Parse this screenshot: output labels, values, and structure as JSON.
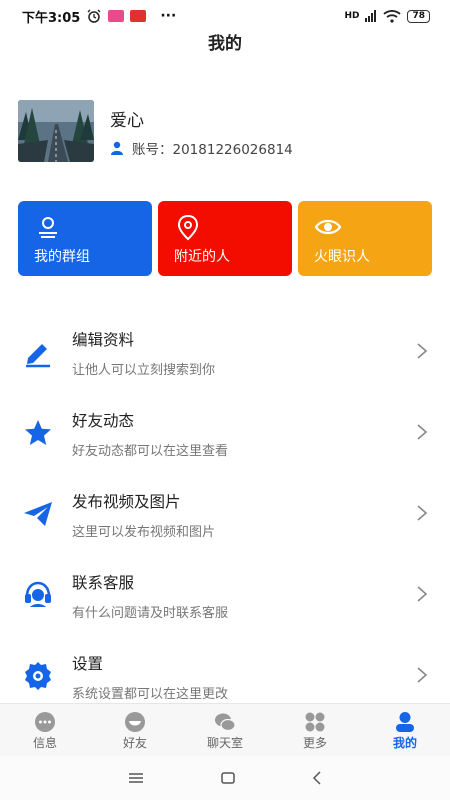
{
  "status": {
    "time": "下午3:05",
    "dots": "···",
    "battery": "78",
    "network": "HD"
  },
  "header": {
    "title": "我的"
  },
  "profile": {
    "name": "爱心",
    "account": "账号：20181226026814"
  },
  "cards": [
    {
      "label": "我的群组",
      "color": "#1565e6",
      "icon": "group-icon"
    },
    {
      "label": "附近的人",
      "color": "#f20d00",
      "icon": "location-pin-icon"
    },
    {
      "label": "火眼识人",
      "color": "#f5a414",
      "icon": "eye-icon"
    }
  ],
  "menu": [
    {
      "title": "编辑资料",
      "desc": "让他人可以立刻搜索到你",
      "icon": "edit-icon"
    },
    {
      "title": "好友动态",
      "desc": "好友动态都可以在这里查看",
      "icon": "star-icon"
    },
    {
      "title": "发布视频及图片",
      "desc": "这里可以发布视频和图片",
      "icon": "send-icon"
    },
    {
      "title": "联系客服",
      "desc": "有什么问题请及时联系客服",
      "icon": "headset-icon"
    },
    {
      "title": "设置",
      "desc": "系统设置都可以在这里更改",
      "icon": "gear-icon"
    }
  ],
  "tabs": [
    {
      "label": "信息",
      "icon": "message-icon"
    },
    {
      "label": "好友",
      "icon": "friend-icon"
    },
    {
      "label": "聊天室",
      "icon": "chatroom-icon"
    },
    {
      "label": "更多",
      "icon": "more-grid-icon"
    },
    {
      "label": "我的",
      "icon": "person-icon",
      "active": true
    }
  ],
  "colors": {
    "accent": "#1565e6",
    "tab_inactive": "#999999"
  }
}
